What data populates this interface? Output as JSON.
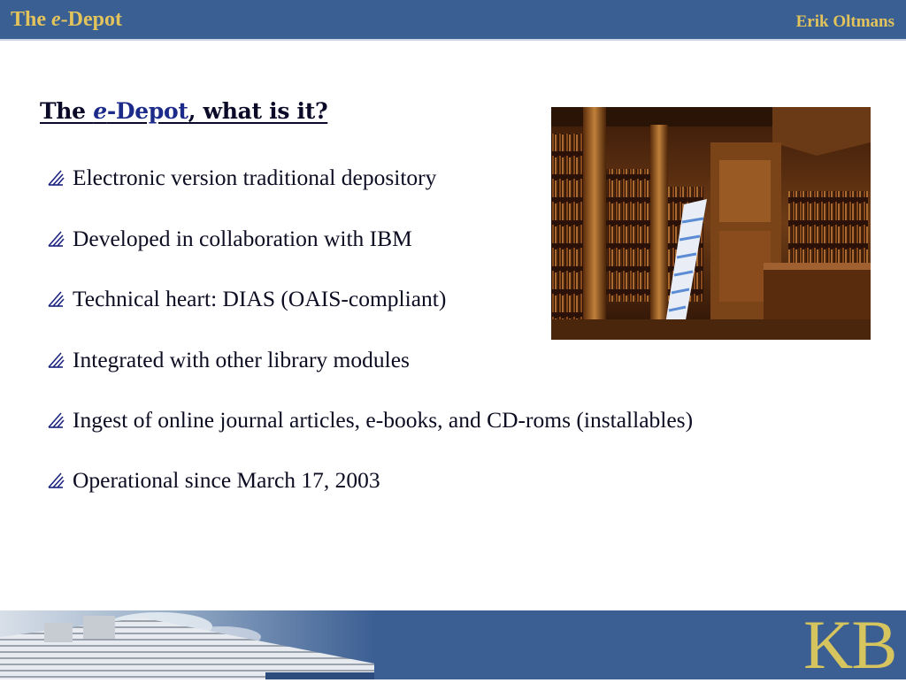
{
  "header": {
    "title_prefix": "The ",
    "title_e": "e",
    "title_suffix": "-Depot",
    "author": "Erik Oltmans"
  },
  "slide": {
    "title_the": "The ",
    "title_e": "e",
    "title_depot": "-Depot",
    "title_rest": ", what is it?"
  },
  "bullets": [
    "Electronic version traditional depository",
    "Developed in collaboration with IBM",
    "Technical heart: DIAS (OAIS-compliant)",
    "Integrated with other library modules",
    "Ingest of online journal articles, e-books, and CD-roms (installables)",
    "Operational since March 17, 2003"
  ],
  "icons": {
    "bullet": "diagonal-lines-bullet-icon"
  },
  "footer": {
    "logo_text": "KB"
  },
  "colors": {
    "header_bar": "#3a5f92",
    "header_text": "#e3c45c",
    "title_brand": "#1c2b8a",
    "footer_bar": "#3c5f93",
    "logo": "#d6c45e"
  }
}
